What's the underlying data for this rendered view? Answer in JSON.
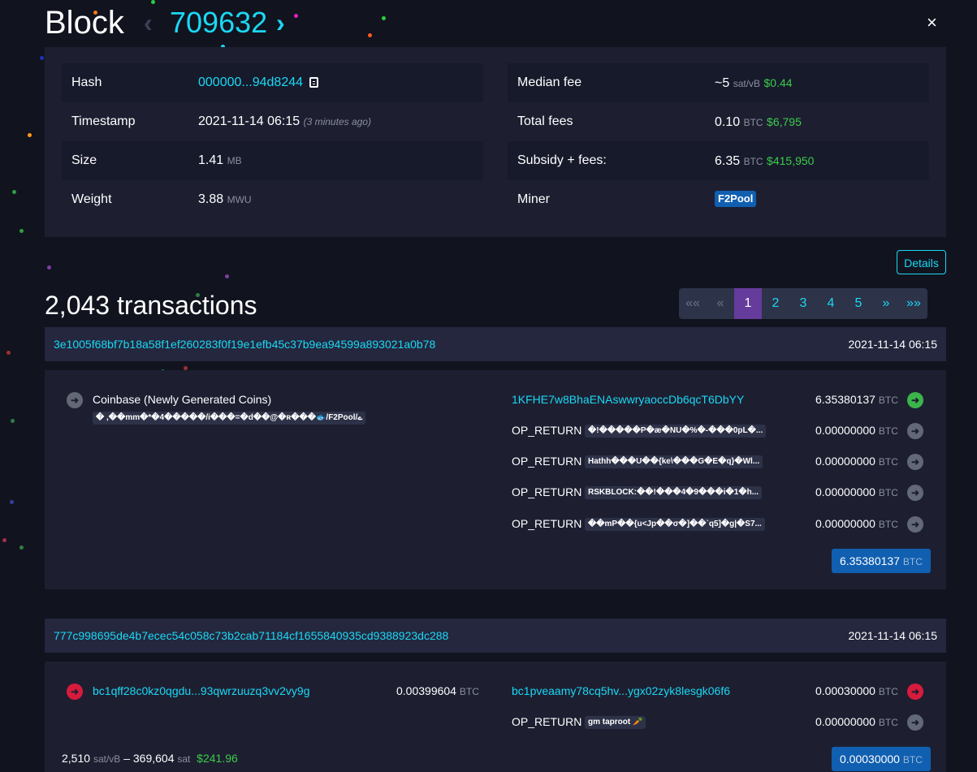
{
  "block": {
    "title": "Block",
    "prev_icon": "chevron-left-icon",
    "height": "709632",
    "next_icon": "chevron-right-icon",
    "close": "×"
  },
  "summary": {
    "left": [
      {
        "label": "Hash",
        "value": "000000...94d8244",
        "icon": "copy-icon"
      },
      {
        "label": "Timestamp",
        "value": "2021-11-14 06:15",
        "extra": "(3 minutes ago)"
      },
      {
        "label": "Size",
        "value": "1.41",
        "unit": "MB"
      },
      {
        "label": "Weight",
        "value": "3.88",
        "unit": "MWU"
      }
    ],
    "right": [
      {
        "label": "Median fee",
        "value": "~5",
        "unit": "sat/vB",
        "fiat": "$0.44"
      },
      {
        "label": "Total fees",
        "value": "0.10",
        "unit": "BTC",
        "fiat": "$6,795"
      },
      {
        "label": "Subsidy + fees:",
        "value": "6.35",
        "unit": "BTC",
        "fiat": "$415,950"
      },
      {
        "label": "Miner",
        "badge": "F2Pool"
      }
    ]
  },
  "details_button": "Details",
  "tx_count": "2,043 transactions",
  "pagination": [
    "««",
    "«",
    "1",
    "2",
    "3",
    "4",
    "5",
    "»",
    "»»"
  ],
  "transactions": [
    {
      "txid": "3e1005f68bf7b18a58f1ef260283f0f19e1efb45c37b9ea94599a893021a0b78",
      "time": "2021-11-14 06:15",
      "input_label": "Coinbase (Newly Generated Coins)",
      "input_data": "� ,��mm�*�4�����/i���=�d��@�ʀ���🐟/F2Pool/ے",
      "outputs": [
        {
          "address": "1KFHE7w8BhaENAswwryaoccDb6qcT6DbYY",
          "amount": "6.35380137",
          "unit": "BTC"
        },
        {
          "address": "OP_RETURN",
          "data": "�!�����P�æ�NU�%�-���0pL�...",
          "amount": "0.00000000",
          "unit": "BTC"
        },
        {
          "address": "OP_RETURN",
          "data": "Hathh���U��{ke\\���G�E�q}�Wl...",
          "amount": "0.00000000",
          "unit": "BTC"
        },
        {
          "address": "OP_RETURN",
          "data": "RSKBLOCK:��!���4�9���i�1�h...",
          "amount": "0.00000000",
          "unit": "BTC"
        },
        {
          "address": "OP_RETURN",
          "data": "��mP��{u<Jp��σ�]��`q5]�g|�S7...",
          "amount": "0.00000000",
          "unit": "BTC"
        }
      ],
      "total": "6.35380137",
      "total_unit": "BTC"
    },
    {
      "txid": "777c998695de4b7ecec54c058c73b2cab71184cf1655840935cd9388923dc288",
      "time": "2021-11-14 06:15",
      "input_address": "bc1qff28c0kz0qgdu...93qwrzuuzq3vv2vy9g",
      "input_amount": "0.00399604",
      "input_unit": "BTC",
      "outputs": [
        {
          "address": "bc1pveaamy78cq5hv...ygx02zyk8lesgk06f6",
          "amount": "0.00030000",
          "unit": "BTC"
        },
        {
          "address": "OP_RETURN",
          "data": "gm taproot 🥕",
          "amount": "0.00000000",
          "unit": "BTC"
        }
      ],
      "fee_rate": "2,510",
      "fee_rate_unit": "sat/vB",
      "fee_sep": "–",
      "fee": "369,604",
      "fee_unit": "sat",
      "fee_fiat": "$241.96",
      "total": "0.00030000",
      "total_unit": "BTC"
    }
  ],
  "colors": {
    "background": "#11131f",
    "panel": "#1d1f31",
    "accent": "#1bd8f4",
    "fiat_green": "#3bcc49",
    "badge_blue": "#105fb0",
    "active_page": "#653b9c",
    "spent_red": "#d81b3c"
  }
}
